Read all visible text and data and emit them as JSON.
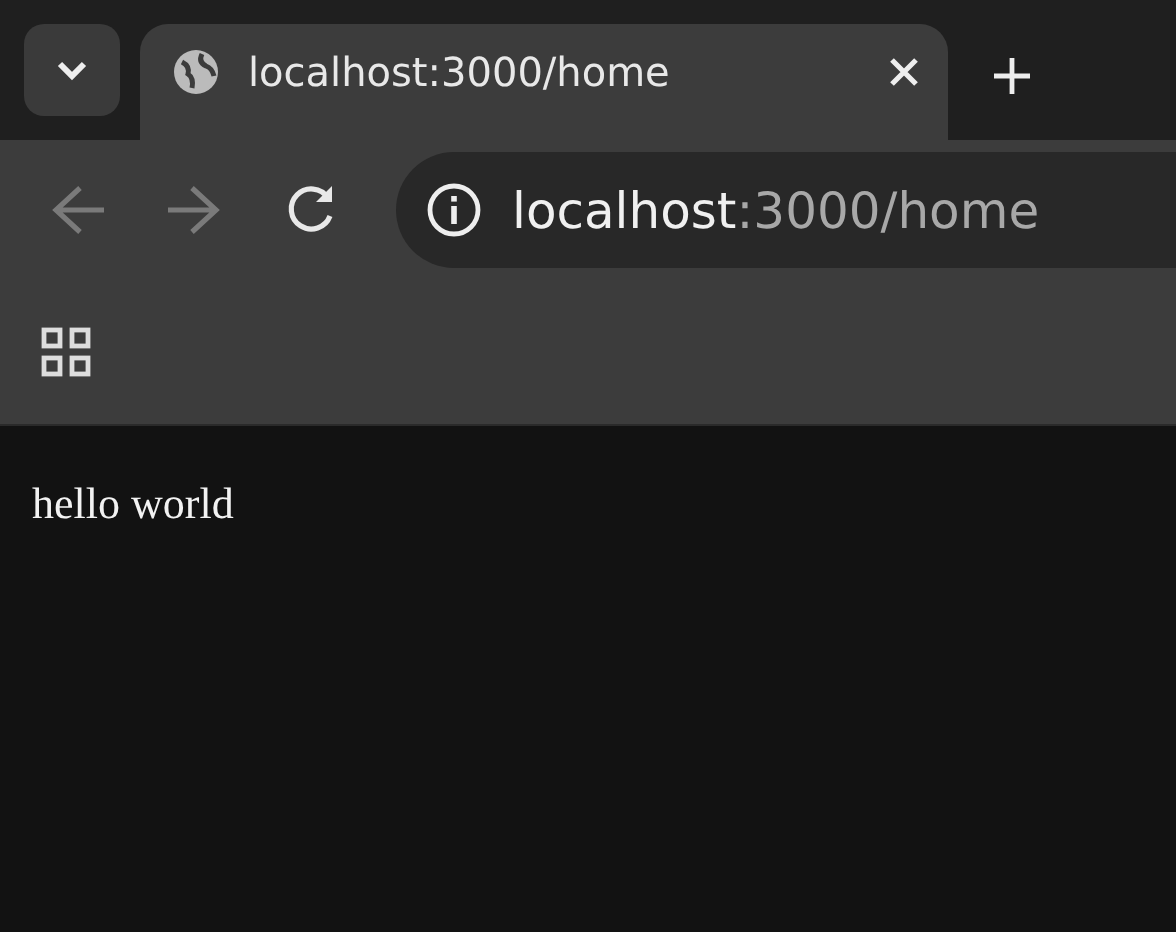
{
  "tab_strip": {
    "tabs": [
      {
        "title": "localhost:3000/home",
        "selected": true
      }
    ]
  },
  "toolbar": {
    "nav_buttons": [
      {
        "kind": "back",
        "disabled": true
      },
      {
        "kind": "forward",
        "disabled": true
      },
      {
        "kind": "reload",
        "disabled": false
      }
    ],
    "address": {
      "host": "localhost",
      "path": ":3000/home"
    }
  },
  "page": {
    "text": "hello world"
  }
}
